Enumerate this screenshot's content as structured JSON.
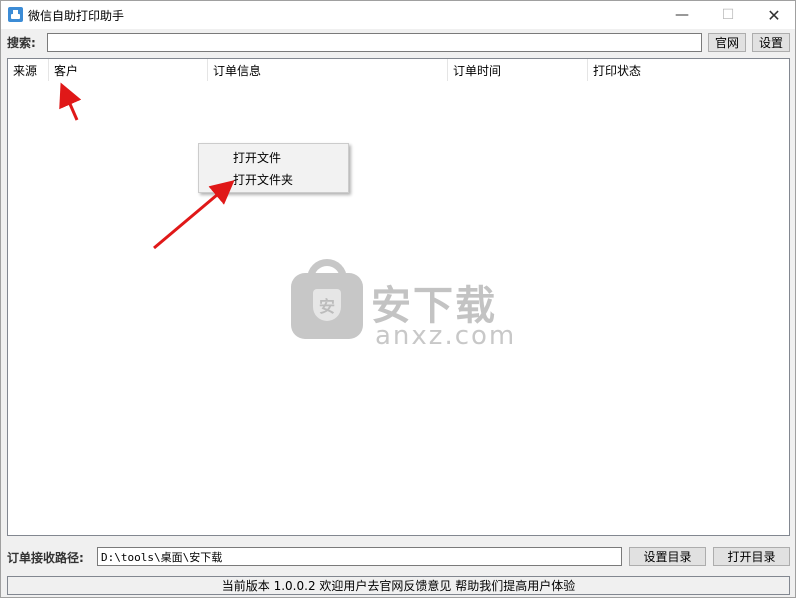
{
  "window": {
    "title": "微信自助打印助手",
    "minimize_glyph": "—",
    "maximize_glyph": "☐",
    "close_glyph": "✕"
  },
  "search": {
    "label": "搜索:",
    "value": "",
    "website_button": "官网",
    "settings_button": "设置"
  },
  "list": {
    "columns": [
      "来源",
      "客户",
      "订单信息",
      "订单时间",
      "打印状态"
    ]
  },
  "context_menu": {
    "items": [
      "打开文件",
      "打开文件夹"
    ]
  },
  "watermark": {
    "brand": "安下载",
    "domain": "anxz.com",
    "shield_glyph": "安"
  },
  "path": {
    "label": "订单接收路径:",
    "value": "D:\\tools\\桌面\\安下载",
    "set_dir_button": "设置目录",
    "open_dir_button": "打开目录"
  },
  "status": {
    "text": "当前版本 1.0.0.2 欢迎用户去官网反馈意见 帮助我们提高用户体验"
  },
  "colors": {
    "arrow": "#e01818",
    "accent_icon": "#3c8cd6"
  }
}
